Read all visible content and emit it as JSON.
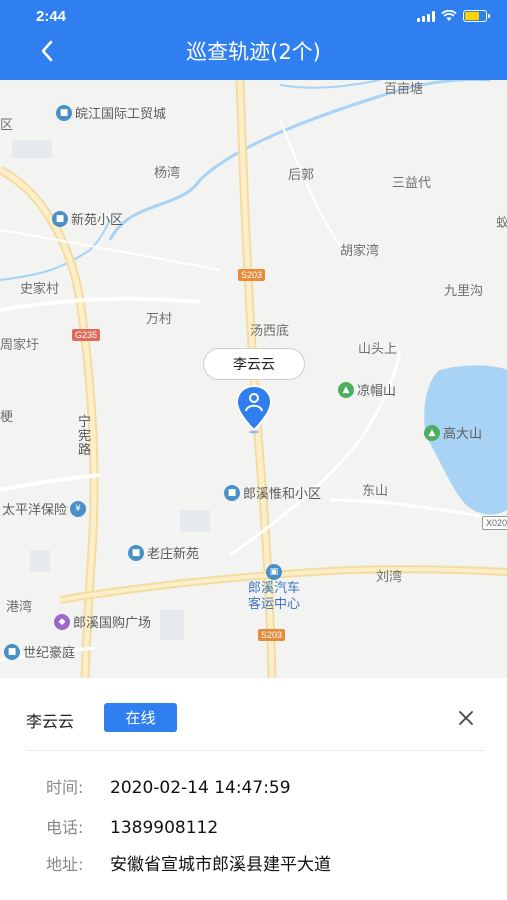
{
  "status_bar": {
    "time": "2:44"
  },
  "header": {
    "title": "巡查轨迹(2个)"
  },
  "map": {
    "labels": {
      "baimiantang": "百亩塘",
      "qu": "区",
      "yangwan": "杨湾",
      "houguo": "后郭",
      "sanyidai": "三益代",
      "hujiawan": "胡家湾",
      "jiulihou": "九里沟",
      "shijiacun": "史家村",
      "wancun": "万村",
      "tangxidi": "汤西底",
      "shantoushang": "山头上",
      "zhoujiayu": "周家圩",
      "geng": "梗",
      "ningxuanlu": "宁\n宪\n路",
      "dongshan": "东山",
      "liuwan": "刘湾",
      "gangwan": "港湾",
      "yi": "蚁"
    },
    "pois": {
      "wanjiang": "皖江国际工贸城",
      "xinyuan": "新苑小区",
      "liangmaoshan": "凉帽山",
      "gaodashan": "高大山",
      "langxi_weihe": "郎溪惟和小区",
      "taipingyang": "太平洋保险",
      "laozhuang": "老庄新苑",
      "bus_station": "郎溪汽车\n客运中心",
      "guogou": "郎溪国购广场",
      "shiji": "世纪豪庭"
    },
    "road_badges": {
      "s203a": "S203",
      "g235": "G235",
      "s203b": "S203",
      "x020": "X020"
    },
    "marker_label": "李云云"
  },
  "panel": {
    "name": "李云云",
    "status": "在线",
    "rows": [
      {
        "key": "时间:",
        "value": "2020-02-14 14:47:59"
      },
      {
        "key": "电话:",
        "value": "1389908112"
      },
      {
        "key": "地址:",
        "value": "安徽省宣城市郎溪县建平大道"
      }
    ]
  },
  "colors": {
    "accent": "#2f7ff0",
    "battery": "#ffd400"
  }
}
